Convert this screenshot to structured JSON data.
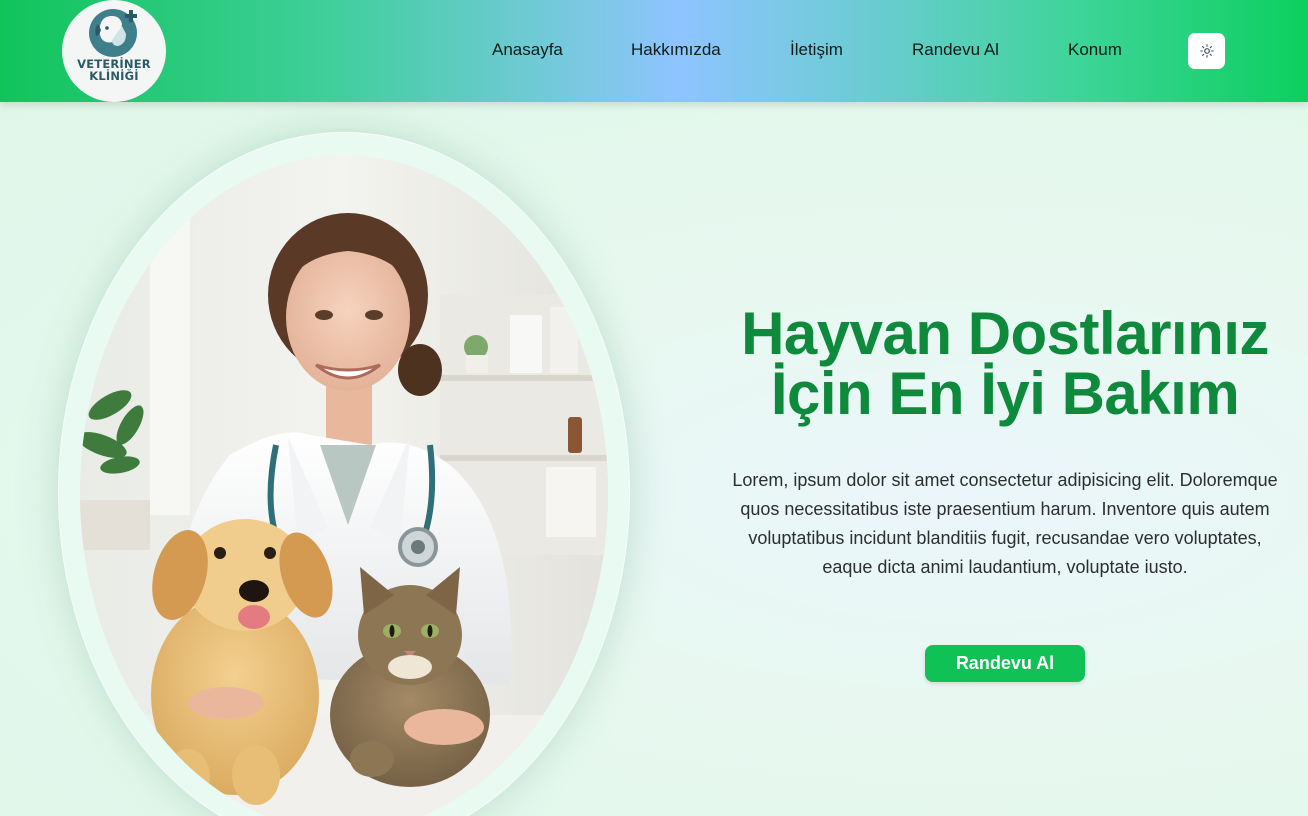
{
  "logo": {
    "line1": "VETERİNER",
    "line2": "KLİNİĞİ",
    "icon": "dog-cat-plus-icon"
  },
  "nav": [
    {
      "label": "Anasayfa"
    },
    {
      "label": "Hakkımızda"
    },
    {
      "label": "İletişim"
    },
    {
      "label": "Randevu Al"
    },
    {
      "label": "Konum"
    }
  ],
  "theme_toggle": {
    "icon": "sun-icon"
  },
  "hero": {
    "title_line1": "Hayvan Dostlarınız",
    "title_line2": "İçin En İyi Bakım",
    "description": "Lorem, ipsum dolor sit amet consectetur adipisicing elit. Doloremque quos necessitatibus iste praesentium harum. Inventore quis autem voluptatibus incidunt blanditiis fugit, recusandae vero voluptates, eaque dicta animi laudantium, voluptate iusto.",
    "cta_label": "Randevu Al",
    "image": "veterinarian-with-puppy-and-cat-photo"
  },
  "colors": {
    "brand_green": "#10c255",
    "title_green": "#0f8a3c",
    "background": "#e6f8ef"
  }
}
